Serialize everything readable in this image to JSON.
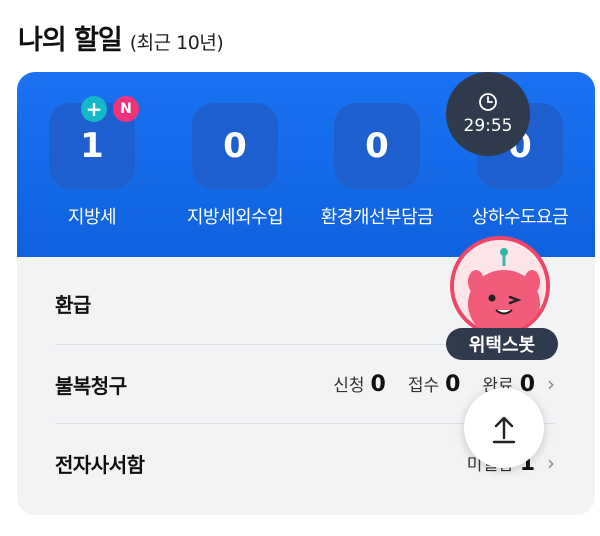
{
  "header": {
    "title": "나의 할일",
    "subtitle": "(최근 10년)"
  },
  "summary": {
    "tiles": [
      {
        "label": "지방세",
        "count": "1"
      },
      {
        "label": "지방세외수입",
        "count": "0"
      },
      {
        "label": "환경개선부담금",
        "count": "0"
      },
      {
        "label": "상하수도요금",
        "count": "0"
      }
    ],
    "badges": {
      "plus": "+",
      "new": "N"
    }
  },
  "timer": {
    "text": "29:55",
    "icon": "clock-icon"
  },
  "rows": {
    "refund": {
      "label": "환급"
    },
    "appeal": {
      "label": "불복청구",
      "stats": [
        {
          "label": "신청",
          "value": "0"
        },
        {
          "label": "접수",
          "value": "0"
        },
        {
          "label": "완료",
          "value": "0"
        }
      ]
    },
    "mailbox": {
      "label": "전자사서함",
      "unread_label": "미열람",
      "unread_value": "1"
    }
  },
  "bot": {
    "label": "위택스봇"
  },
  "colors": {
    "primary": "#0f62de",
    "tile": "#1e5fd0",
    "bot_ring": "#ef4566",
    "overlay": "#2f3a4d"
  }
}
